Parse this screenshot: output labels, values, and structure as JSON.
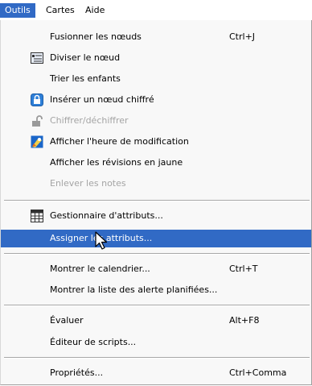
{
  "menubar": {
    "items": [
      {
        "label": "Outils",
        "active": true
      },
      {
        "label": "Cartes"
      },
      {
        "label": "Aide"
      }
    ]
  },
  "menu": {
    "items": [
      {
        "label": "Fusionner les nœuds",
        "shortcut": "Ctrl+J"
      },
      {
        "label": "Diviser le nœud",
        "icon": "split-node-icon"
      },
      {
        "label": "Trier les enfants"
      },
      {
        "label": "Insérer un nœud chiffré",
        "icon": "encrypted-node-icon"
      },
      {
        "label": "Chiffrer/déchiffrer",
        "icon": "lock-icon",
        "disabled": true
      },
      {
        "label": "Afficher l'heure de modification",
        "icon": "clock-icon"
      },
      {
        "label": "Afficher les révisions en jaune"
      },
      {
        "label": "Enlever les notes",
        "disabled": true
      },
      {
        "label": "Gestionnaire d'attributs...",
        "icon": "attribute-table-icon"
      },
      {
        "label": "Assigner les attributs...",
        "highlighted": true
      },
      {
        "label": "Montrer le calendrier...",
        "shortcut": "Ctrl+T"
      },
      {
        "label": "Montrer la liste des alerte planifiées..."
      },
      {
        "label": "Évaluer",
        "shortcut": "Alt+F8"
      },
      {
        "label": "Éditeur de scripts..."
      },
      {
        "label": "Propriétés...",
        "shortcut": "Ctrl+Comma"
      }
    ]
  },
  "colors": {
    "highlight": "#316ac5",
    "disabled_text": "#a4a4a4",
    "menu_background": "#f8f8f8"
  }
}
